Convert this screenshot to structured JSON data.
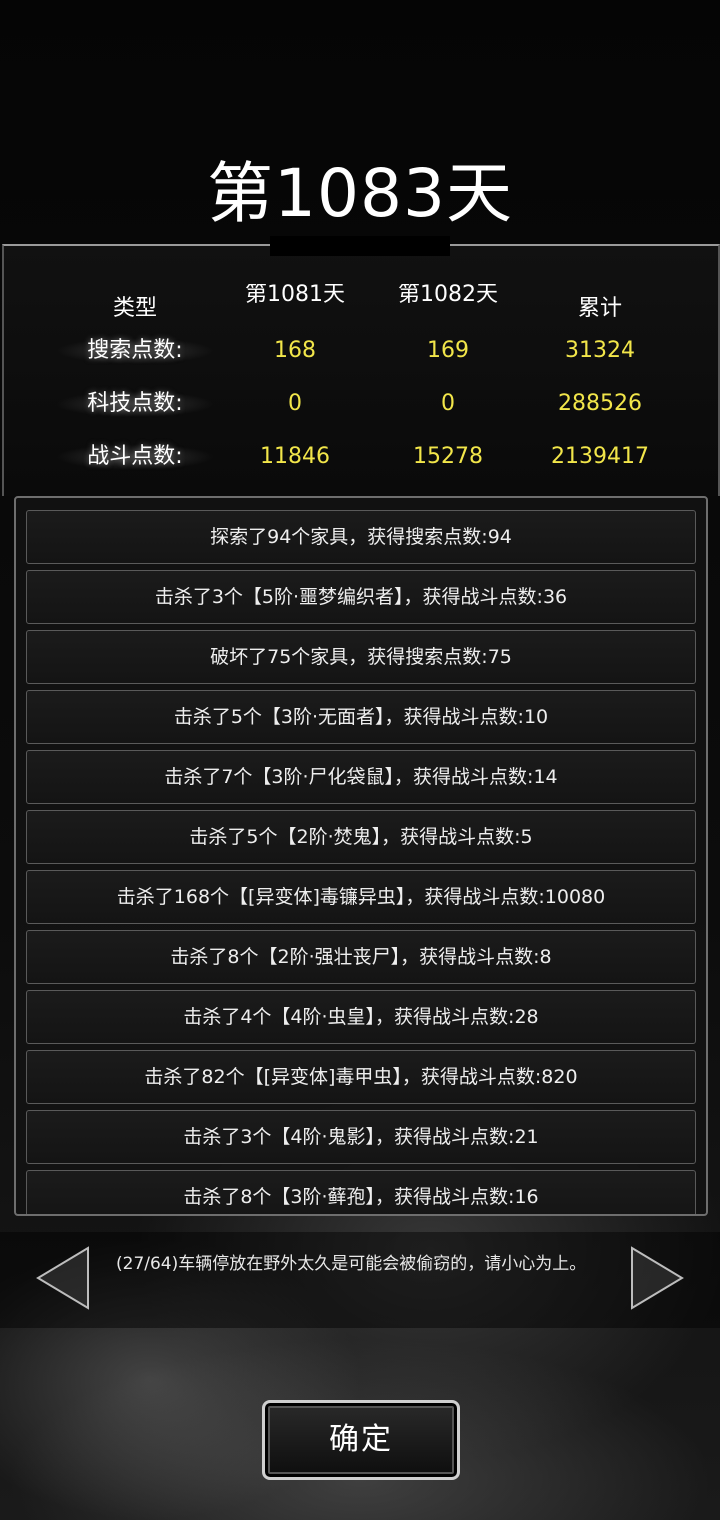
{
  "header": {
    "day_title": "第1083天"
  },
  "stats": {
    "headers": [
      "类型",
      "第1081天",
      "第1082天",
      "累计"
    ],
    "rows": [
      {
        "label": "搜索点数:",
        "d1081": "168",
        "d1082": "169",
        "total": "31324"
      },
      {
        "label": "科技点数:",
        "d1081": "0",
        "d1082": "0",
        "total": "288526"
      },
      {
        "label": "战斗点数:",
        "d1081": "11846",
        "d1082": "15278",
        "total": "2139417"
      }
    ]
  },
  "log": [
    "探索了94个家具，获得搜索点数:94",
    "击杀了3个【5阶·噩梦编织者】，获得战斗点数:36",
    "破坏了75个家具，获得搜索点数:75",
    "击杀了5个【3阶·无面者】，获得战斗点数:10",
    "击杀了7个【3阶·尸化袋鼠】，获得战斗点数:14",
    "击杀了5个【2阶·焚鬼】，获得战斗点数:5",
    "击杀了168个【[异变体]毒镰异虫】，获得战斗点数:10080",
    "击杀了8个【2阶·强壮丧尸】，获得战斗点数:8",
    "击杀了4个【4阶·虫皇】，获得战斗点数:28",
    "击杀了82个【[异变体]毒甲虫】，获得战斗点数:820",
    "击杀了3个【4阶·鬼影】，获得战斗点数:21",
    "击杀了8个【3阶·藓孢】，获得战斗点数:16"
  ],
  "tip": {
    "text": "(27/64)车辆停放在野外太久是可能会被偷窃的，请小心为上。"
  },
  "icons": {
    "prev": "triangle-left-icon",
    "next": "triangle-right-icon"
  },
  "buttons": {
    "confirm": "确定"
  },
  "colors": {
    "value_yellow": "#f2e64a",
    "background": "#000000"
  }
}
